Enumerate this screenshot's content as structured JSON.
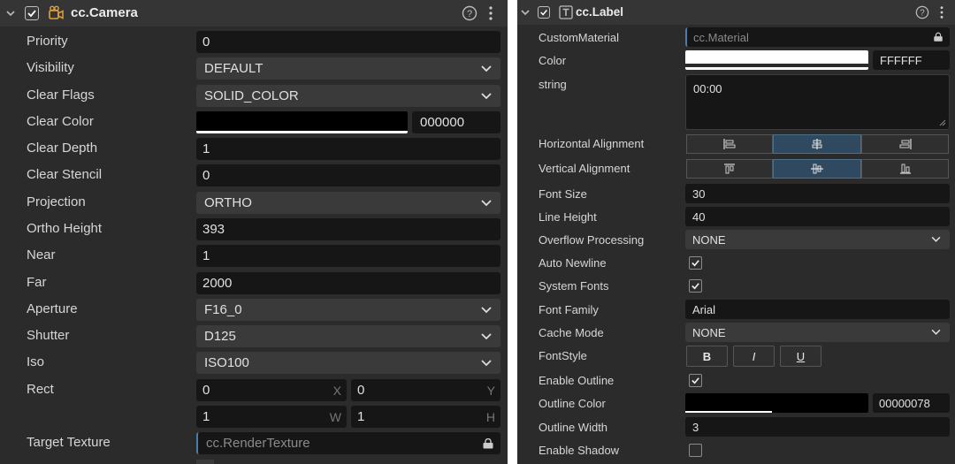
{
  "camera": {
    "title": "cc.Camera",
    "rows": {
      "priority": {
        "label": "Priority",
        "value": "0"
      },
      "visibility": {
        "label": "Visibility",
        "value": "DEFAULT"
      },
      "clear_flags": {
        "label": "Clear Flags",
        "value": "SOLID_COLOR"
      },
      "clear_color": {
        "label": "Clear Color",
        "hex": "000000"
      },
      "clear_depth": {
        "label": "Clear Depth",
        "value": "1"
      },
      "clear_stencil": {
        "label": "Clear Stencil",
        "value": "0"
      },
      "projection": {
        "label": "Projection",
        "value": "ORTHO"
      },
      "ortho_height": {
        "label": "Ortho Height",
        "value": "393"
      },
      "near": {
        "label": "Near",
        "value": "1"
      },
      "far": {
        "label": "Far",
        "value": "2000"
      },
      "aperture": {
        "label": "Aperture",
        "value": "F16_0"
      },
      "shutter": {
        "label": "Shutter",
        "value": "D125"
      },
      "iso": {
        "label": "Iso",
        "value": "ISO100"
      },
      "rect": {
        "label": "Rect",
        "x": "0",
        "y": "0",
        "w": "1",
        "h": "1",
        "x_axis": "X",
        "y_axis": "Y",
        "w_axis": "W",
        "h_axis": "H"
      },
      "target_texture": {
        "label": "Target Texture",
        "placeholder": "cc.RenderTexture"
      }
    }
  },
  "label": {
    "title": "cc.Label",
    "rows": {
      "custom_material": {
        "label": "CustomMaterial",
        "placeholder": "cc.Material"
      },
      "color": {
        "label": "Color",
        "hex": "FFFFFF"
      },
      "string": {
        "label": "string",
        "value": "00:00"
      },
      "h_align": {
        "label": "Horizontal Alignment",
        "selected": "center"
      },
      "v_align": {
        "label": "Vertical Alignment",
        "selected": "center"
      },
      "font_size": {
        "label": "Font Size",
        "value": "30"
      },
      "line_height": {
        "label": "Line Height",
        "value": "40"
      },
      "overflow": {
        "label": "Overflow Processing",
        "value": "NONE"
      },
      "auto_newline": {
        "label": "Auto Newline",
        "checked": true
      },
      "system_fonts": {
        "label": "System Fonts",
        "checked": true
      },
      "font_family": {
        "label": "Font Family",
        "value": "Arial"
      },
      "cache_mode": {
        "label": "Cache Mode",
        "value": "NONE"
      },
      "font_style": {
        "label": "FontStyle",
        "bold": "B",
        "italic": "I",
        "underline": "U"
      },
      "enable_outline": {
        "label": "Enable Outline",
        "checked": true
      },
      "outline_color": {
        "label": "Outline Color",
        "hex": "00000078"
      },
      "outline_width": {
        "label": "Outline Width",
        "value": "3"
      },
      "enable_shadow": {
        "label": "Enable Shadow",
        "checked": false
      }
    }
  },
  "colors": {
    "panel_bg": "#2b2b2b",
    "header_bg": "#353535",
    "field_bg": "#161616",
    "select_bg": "#3a3a3a",
    "active_segment": "#2f4a60",
    "camera_icon": "#e0a23c"
  },
  "icons": [
    "chevron-down-icon",
    "checkbox-icon",
    "camera-component-icon",
    "label-component-icon",
    "help-icon",
    "more-icon",
    "dropdown-arrow-icon",
    "lock-icon",
    "align-left-icon",
    "align-center-icon",
    "align-right-icon",
    "align-top-icon",
    "align-middle-icon",
    "align-bottom-icon",
    "resize-grip-icon",
    "checkmark-icon"
  ]
}
